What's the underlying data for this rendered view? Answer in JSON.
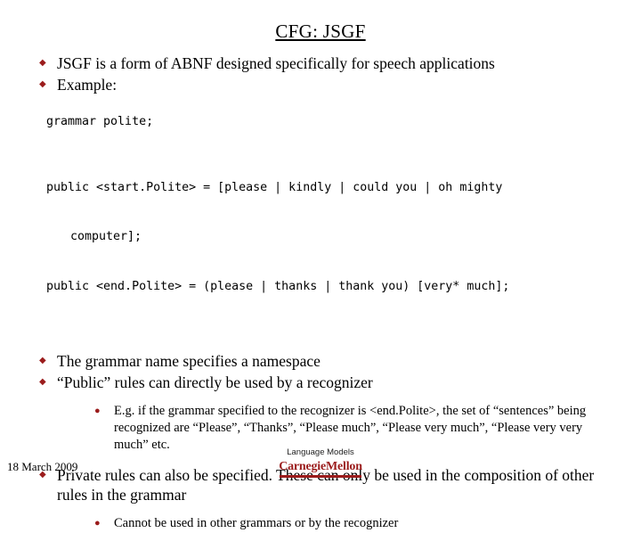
{
  "slide": {
    "title": "CFG: JSGF",
    "bullets_top": [
      {
        "marker": "u",
        "text": "JSGF is a form of ABNF designed specifically for speech applications"
      },
      {
        "marker": "u",
        "text": "Example:"
      }
    ],
    "code_block_1": "grammar polite;",
    "code_block_2_line1": "public <start.Polite> = [please | kindly | could you | oh mighty",
    "code_block_2_line2": "computer];",
    "code_block_2_line3": "public <end.Polite> = (please | thanks | thank you) [very* much];",
    "bullets_mid": [
      {
        "marker": "u",
        "text": "The grammar name specifies a namespace"
      },
      {
        "marker": "u",
        "text": "“Public” rules can directly be used by a recognizer"
      }
    ],
    "subbullet_1": {
      "marker": "l",
      "text": "E.g. if the grammar specified to the recognizer is <end.Polite>, the set of “sentences” being recognized are “Please”, “Thanks”, “Please much”, “Please very much”, “Please very very much” etc."
    },
    "bullet_private": {
      "marker": "u",
      "text": "Private rules can also be specified. These can only be used in the composition of other rules in the grammar"
    },
    "subbullet_2": {
      "marker": "l",
      "text": "Cannot be used in other grammars or by the recognizer"
    },
    "footer": {
      "date": "18  March 2009",
      "course": "Language Models",
      "logo_text": "CarnegieMellon"
    },
    "colors": {
      "bullet_marker": "#9b1c1c",
      "logo": "#9b1c1c",
      "text": "#000000"
    }
  }
}
